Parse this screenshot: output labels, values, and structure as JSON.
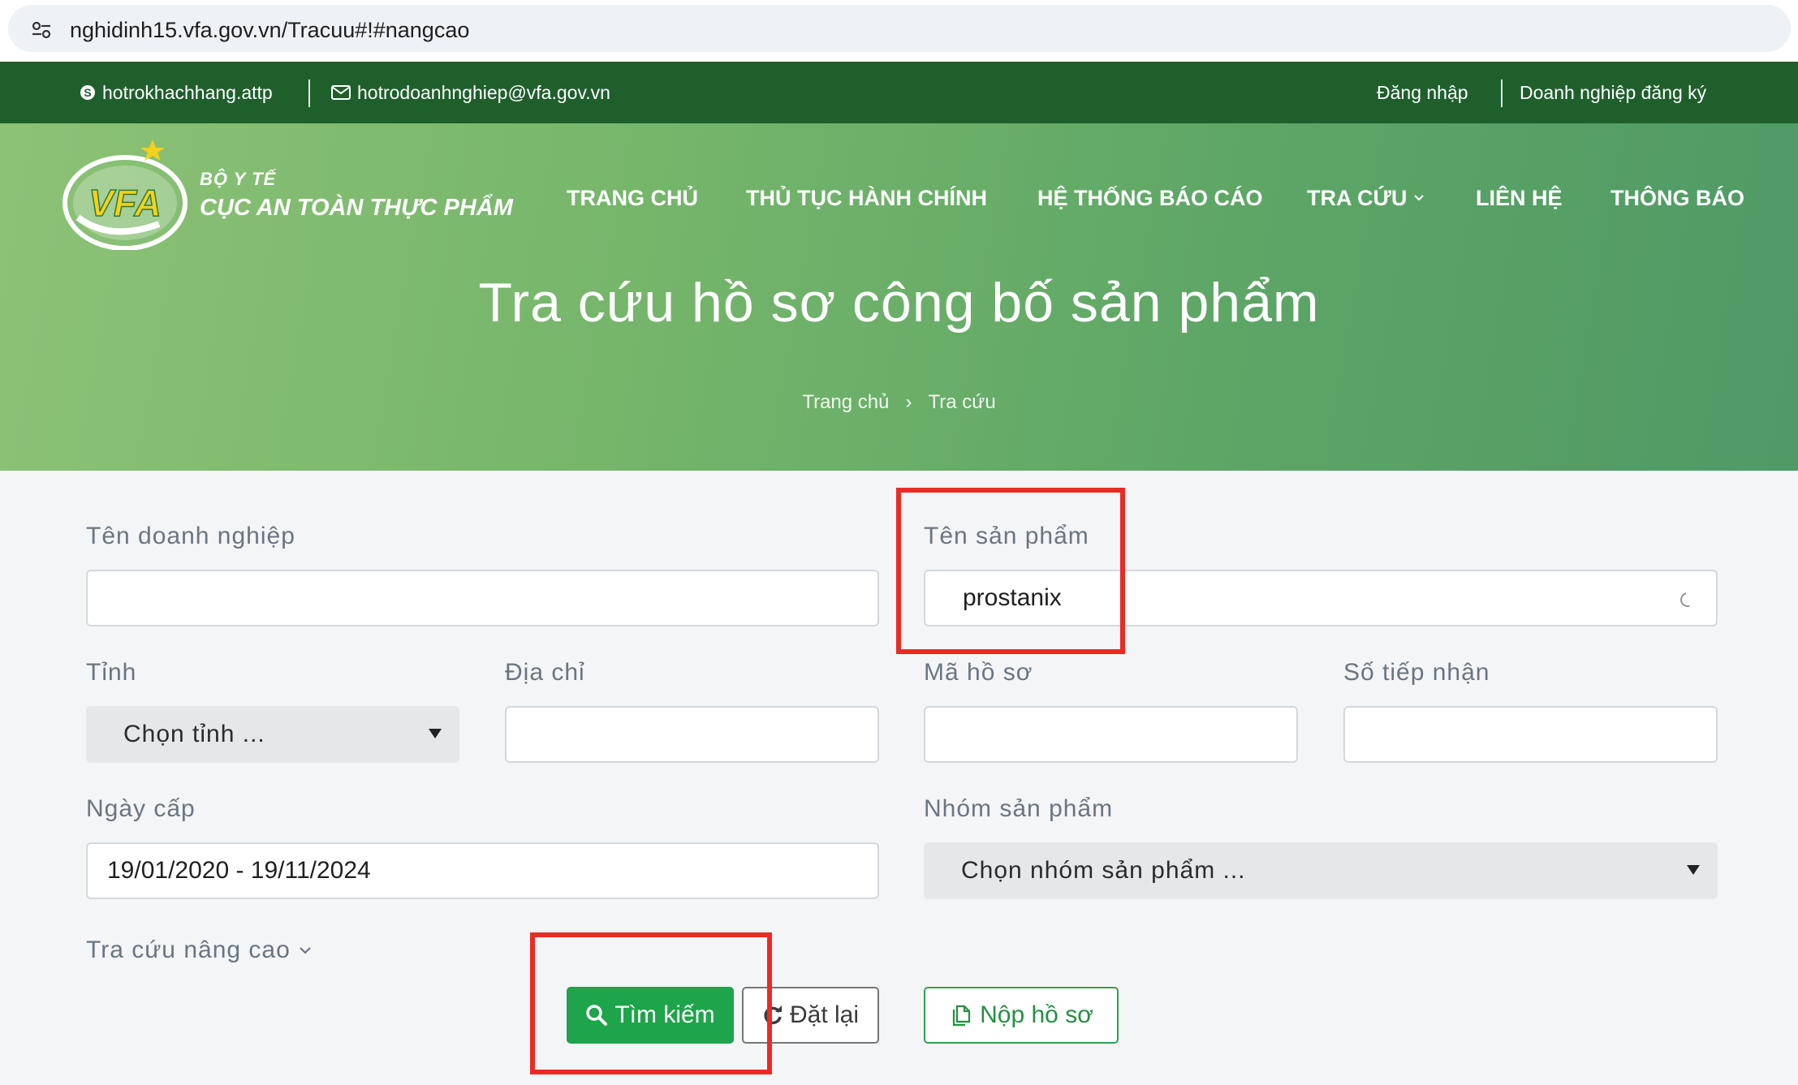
{
  "browser": {
    "url": "nghidinh15.vfa.gov.vn/Tracuu#!#nangcao"
  },
  "topbar": {
    "skype": "hotrokhachhang.attp",
    "email": "hotrodoanhnghiep@vfa.gov.vn",
    "login": "Đăng nhập",
    "register": "Doanh nghiệp đăng ký"
  },
  "brand": {
    "logo_text": "VFA",
    "sub": "BỘ Y TẾ",
    "main": "CỤC AN TOÀN THỰC PHẨM"
  },
  "nav": [
    {
      "label": "TRANG CHỦ"
    },
    {
      "label": "THỦ TỤC HÀNH CHÍNH"
    },
    {
      "label": "HỆ THỐNG BÁO CÁO"
    },
    {
      "label": "TRA CỨU"
    },
    {
      "label": "LIÊN HỆ"
    },
    {
      "label": "THÔNG BÁO"
    }
  ],
  "hero": {
    "title": "Tra cứu hồ sơ công bố sản phẩm",
    "breadcrumb": {
      "home": "Trang chủ",
      "separator": "›",
      "current": "Tra cứu"
    }
  },
  "form": {
    "company_label": "Tên doanh nghiệp",
    "company_value": "",
    "product_label": "Tên sản phẩm",
    "product_value": "prostanix",
    "province_label": "Tỉnh",
    "province_selected": "Chọn tỉnh ...",
    "address_label": "Địa chỉ",
    "address_value": "",
    "record_code_label": "Mã hồ sơ",
    "record_code_value": "",
    "receipt_no_label": "Số tiếp nhận",
    "receipt_no_value": "",
    "issue_date_label": "Ngày cấp",
    "issue_date_value": "19/01/2020 - 19/11/2024",
    "product_group_label": "Nhóm sản phẩm",
    "product_group_selected": "Chọn nhóm sản phẩm ...",
    "advanced_toggle": "Tra cứu nâng cao"
  },
  "buttons": {
    "search": "Tìm kiếm",
    "reset": "Đặt lại",
    "submit": "Nộp hồ sơ"
  },
  "colors": {
    "topbar": "#1f5f2c",
    "accent_green": "#1ea44a",
    "highlight_red": "#ea2b25"
  }
}
